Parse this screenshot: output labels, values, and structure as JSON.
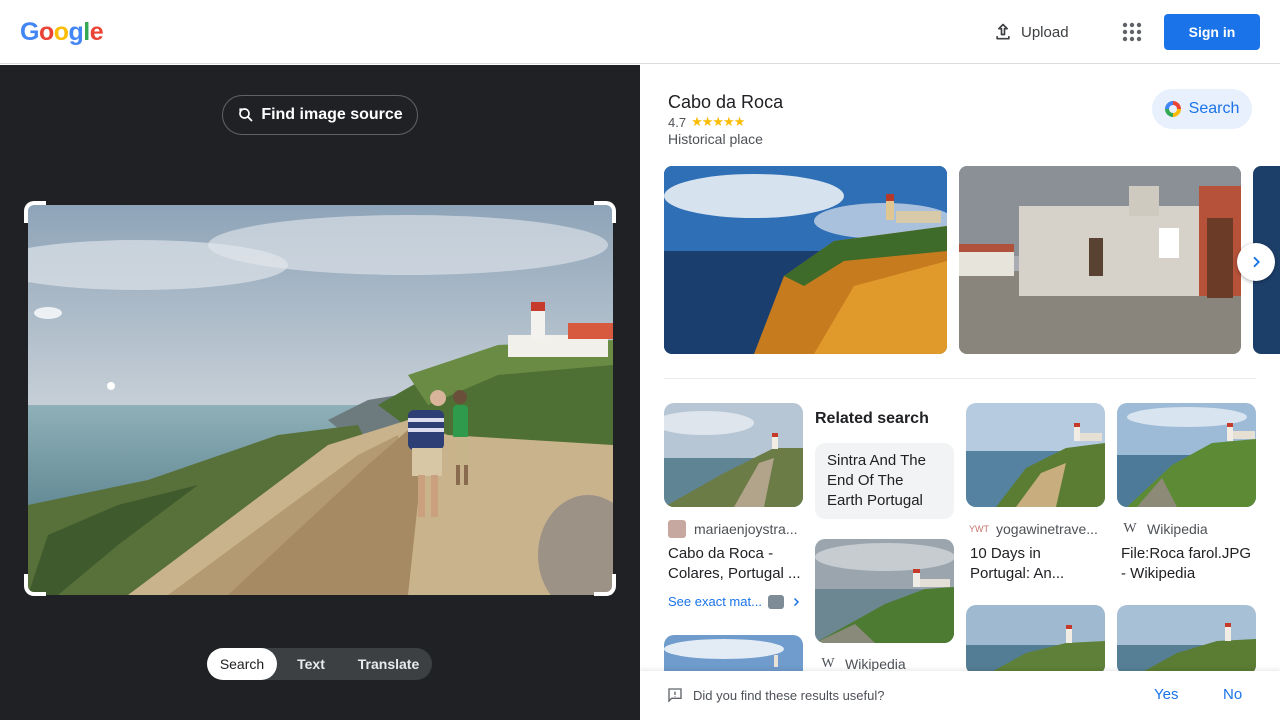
{
  "header": {
    "logo_letters": [
      "G",
      "o",
      "o",
      "g",
      "l",
      "e"
    ],
    "upload_label": "Upload",
    "signin_label": "Sign in"
  },
  "left_panel": {
    "find_image_source_label": "Find image source",
    "modes": [
      "Search",
      "Text",
      "Translate"
    ],
    "active_mode": "Search"
  },
  "entity": {
    "title": "Cabo da Roca",
    "rating": "4.7",
    "stars": "★★★★★",
    "type": "Historical place",
    "search_label": "Search"
  },
  "results": {
    "related_heading": "Related search",
    "related_chip": "Sintra And The End Of The Earth Portugal",
    "items": [
      {
        "source": "mariaenjoystra...",
        "title": "Cabo da Roca - Colares, Portugal ...",
        "exact_match_label": "See exact mat..."
      },
      {
        "source": "yogawinetrave...",
        "title": "10 Days in Portugal: An..."
      },
      {
        "source": "Wikipedia",
        "title": "File:Roca farol.JPG - Wikipedia"
      },
      {
        "source": "Wikipedia",
        "title": ""
      }
    ]
  },
  "feedback": {
    "question": "Did you find these results useful?",
    "yes_label": "Yes",
    "no_label": "No"
  },
  "colors": {
    "accent": "#1a73e8",
    "dark_panel": "#202124",
    "star": "#fbbc04"
  }
}
